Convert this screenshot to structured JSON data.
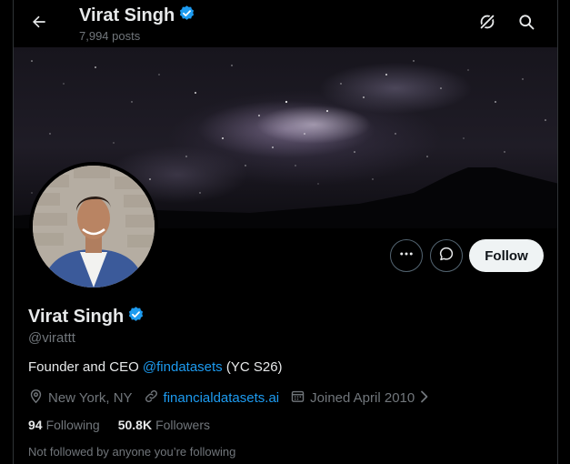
{
  "header": {
    "name": "Virat Singh",
    "posts": "7,994 posts"
  },
  "profile": {
    "name": "Virat Singh",
    "handle": "@virattt",
    "bio_prefix": "Founder and CEO ",
    "bio_mention": "@findatasets",
    "bio_suffix": " (YC S26)",
    "location": "New York, NY",
    "website": "financialdatasets.ai",
    "joined": "Joined April 2010",
    "following_count": "94",
    "following_label": "Following",
    "followers_count": "50.8K",
    "followers_label": "Followers",
    "not_followed": "Not followed by anyone you’re following"
  },
  "actions": {
    "follow_label": "Follow"
  },
  "icons": {
    "back": "back-arrow-icon",
    "grok": "grok-icon",
    "search": "search-icon",
    "verified": "verified-badge-icon",
    "more": "more-icon",
    "message": "message-icon",
    "location": "location-icon",
    "link": "link-icon",
    "calendar": "calendar-icon",
    "chevron": "chevron-right-icon"
  },
  "colors": {
    "accent": "#1d9bf0",
    "background": "#000000",
    "secondary_text": "#71767b"
  }
}
